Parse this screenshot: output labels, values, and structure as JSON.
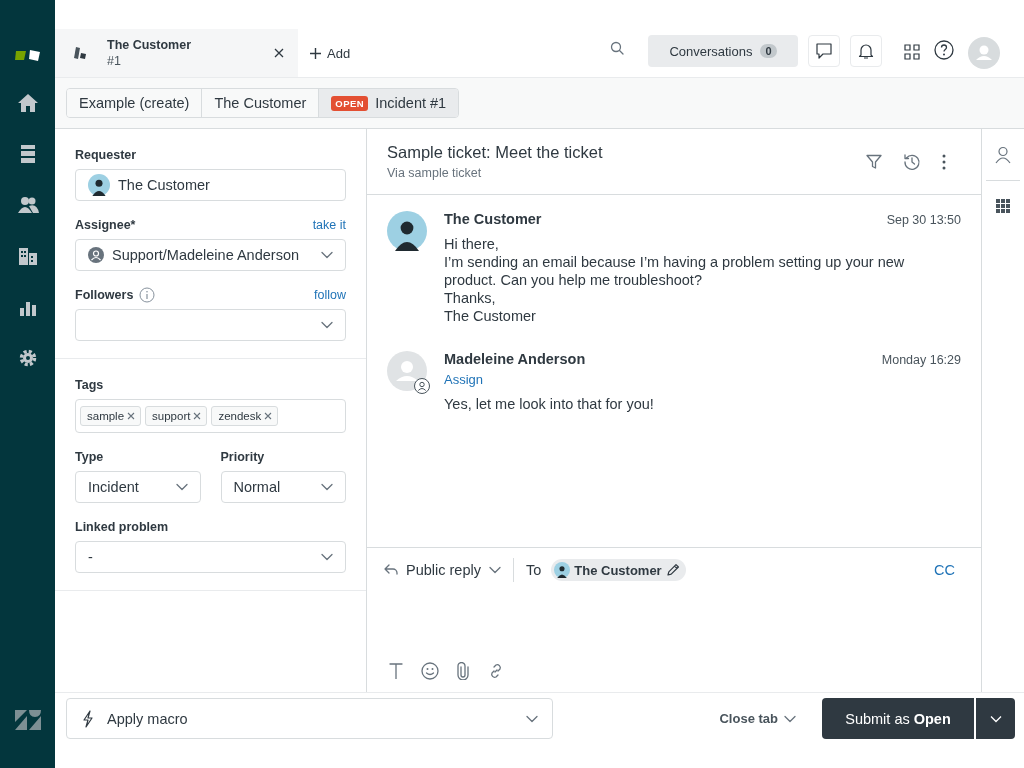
{
  "tabs": [
    {
      "title": "The Customer",
      "subtitle": "#1",
      "selected": true
    }
  ],
  "add_tab": {
    "label": "Add"
  },
  "conversations": {
    "label": "Conversations",
    "count": "0"
  },
  "breadcrumbs": [
    {
      "label": "Example (create)",
      "selected": false
    },
    {
      "label": "The Customer",
      "selected": false
    },
    {
      "label": "Incident #1",
      "badge": "OPEN",
      "selected": true
    }
  ],
  "properties": {
    "requester": {
      "label": "Requester",
      "value": "The Customer"
    },
    "assignee": {
      "label": "Assignee*",
      "action": "take it",
      "value": "Support/Madeleine Anderson"
    },
    "followers": {
      "label": "Followers",
      "action": "follow"
    },
    "tags": {
      "label": "Tags",
      "items": [
        "sample",
        "support",
        "zendesk"
      ]
    },
    "type": {
      "label": "Type",
      "value": "Incident"
    },
    "priority": {
      "label": "Priority",
      "value": "Normal"
    },
    "linked_problem": {
      "label": "Linked problem",
      "value": "-"
    }
  },
  "ticket": {
    "title": "Sample ticket: Meet the ticket",
    "via": "Via sample ticket"
  },
  "messages": [
    {
      "kind": "customer",
      "author": "The Customer",
      "time": "Sep 30 13:50",
      "lines": [
        "Hi there,",
        "I’m sending an email because I’m having a problem setting up your new product. Can you help me troubleshoot?",
        "Thanks,",
        "The Customer"
      ]
    },
    {
      "kind": "agent",
      "author": "Madeleine Anderson",
      "time": "Monday 16:29",
      "action": "Assign",
      "lines": [
        "Yes, let me look into that for you!"
      ]
    }
  ],
  "reply": {
    "mode": "Public reply",
    "to_label": "To",
    "recipient": "The Customer",
    "cc": "CC"
  },
  "footer": {
    "macro": "Apply macro",
    "close": "Close tab",
    "submit": "Submit as **Open**"
  }
}
